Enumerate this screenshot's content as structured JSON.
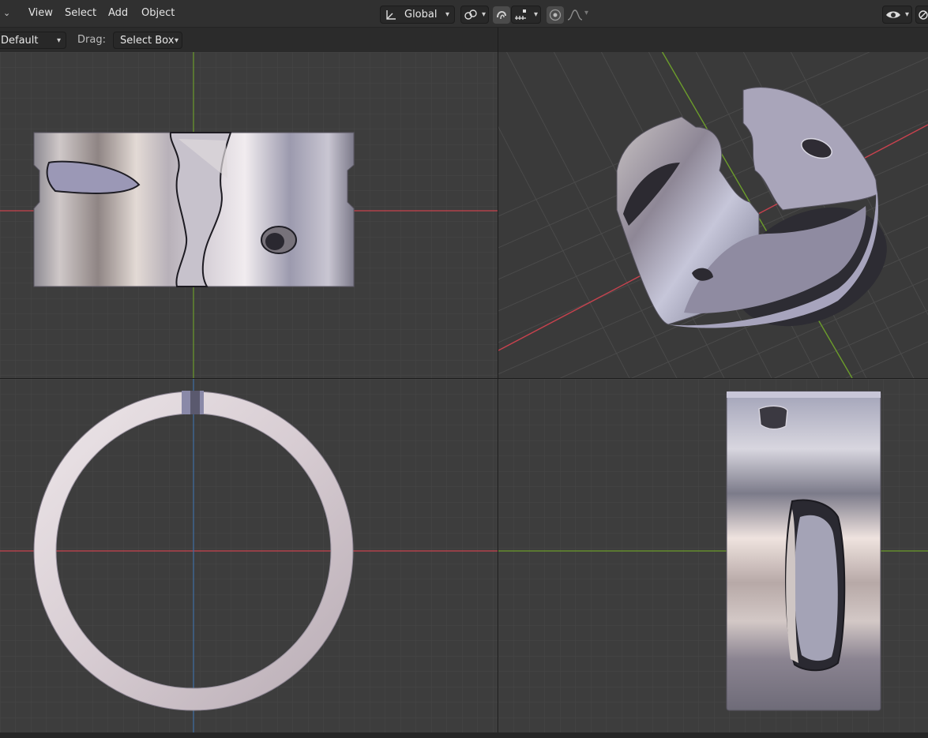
{
  "header": {
    "menus": [
      "View",
      "Select",
      "Add",
      "Object"
    ],
    "transform_orientation": "Global",
    "icons": [
      "collapse-chevron-icon",
      "axes-gizmo-icon",
      "pivot-link-icon",
      "snap-magnet-icon",
      "snap-increment-icon",
      "proportional-edit-icon",
      "falloff-curve-icon",
      "visibility-eye-icon",
      "overlay-icon"
    ]
  },
  "toolbar": {
    "orientation_value": "Default",
    "drag_label": "Drag:",
    "drag_value": "Select Box"
  },
  "colors": {
    "grid_bg": "#3d3d3d",
    "x_axis": "#c8424e",
    "y_axis": "#6c9d2b",
    "z_axis": "#3f6ea3",
    "header_bg": "#303030"
  },
  "viewports": [
    {
      "name": "front-view",
      "axes": [
        "x",
        "z"
      ]
    },
    {
      "name": "perspective-view",
      "axes": [
        "x",
        "y"
      ]
    },
    {
      "name": "top-view",
      "axes": [
        "x",
        "z"
      ]
    },
    {
      "name": "side-view",
      "axes": [
        "y"
      ]
    }
  ]
}
